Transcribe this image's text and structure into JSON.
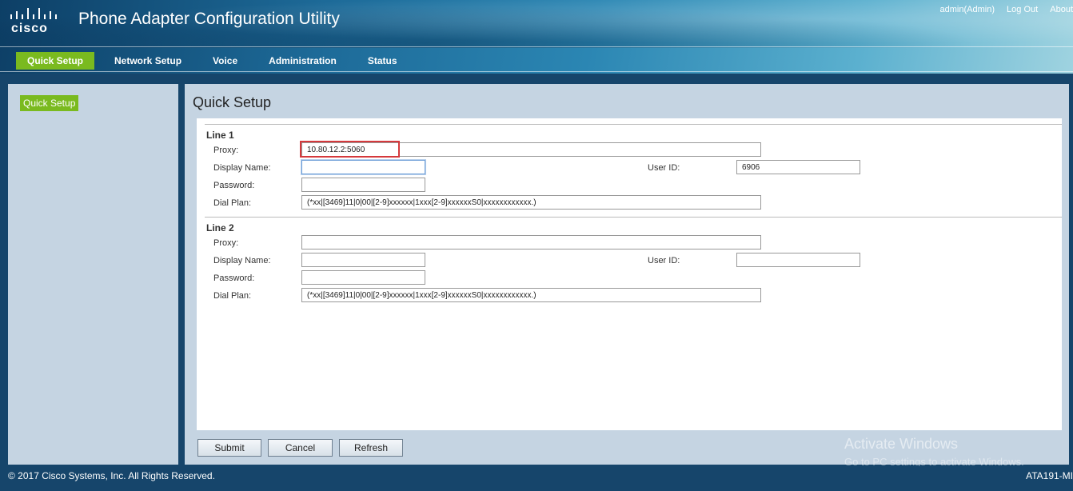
{
  "header": {
    "brand": "cisco",
    "title": "Phone Adapter Configuration Utility",
    "user": "admin(Admin)",
    "logout": "Log Out",
    "about": "About"
  },
  "nav": [
    "Quick Setup",
    "Network Setup",
    "Voice",
    "Administration",
    "Status"
  ],
  "sidebar": {
    "items": [
      "Quick Setup"
    ]
  },
  "page": {
    "title": "Quick Setup"
  },
  "labels": {
    "proxy": "Proxy:",
    "display_name": "Display Name:",
    "password": "Password:",
    "dial_plan": "Dial Plan:",
    "user_id": "User ID:"
  },
  "line1": {
    "title": "Line 1",
    "proxy": "10.80.12.2:5060",
    "display_name": "",
    "user_id": "6906",
    "password": "",
    "dial_plan": "(*xx|[3469]11|0|00|[2-9]xxxxxx|1xxx[2-9]xxxxxxS0|xxxxxxxxxxxx.)"
  },
  "line2": {
    "title": "Line 2",
    "proxy": "",
    "display_name": "",
    "user_id": "",
    "password": "",
    "dial_plan": "(*xx|[3469]11|0|00|[2-9]xxxxxx|1xxx[2-9]xxxxxxS0|xxxxxxxxxxxx.)"
  },
  "buttons": {
    "submit": "Submit",
    "cancel": "Cancel",
    "refresh": "Refresh"
  },
  "watermark": {
    "title": "Activate Windows",
    "subtitle": "Go to PC settings to activate Windows."
  },
  "footer": {
    "copyright": "© 2017 Cisco Systems, Inc. All Rights Reserved.",
    "model": "ATA191-MI"
  },
  "colors": {
    "accent": "#7aba1f",
    "highlight": "#d5393c",
    "panel": "#c5d4e2"
  }
}
